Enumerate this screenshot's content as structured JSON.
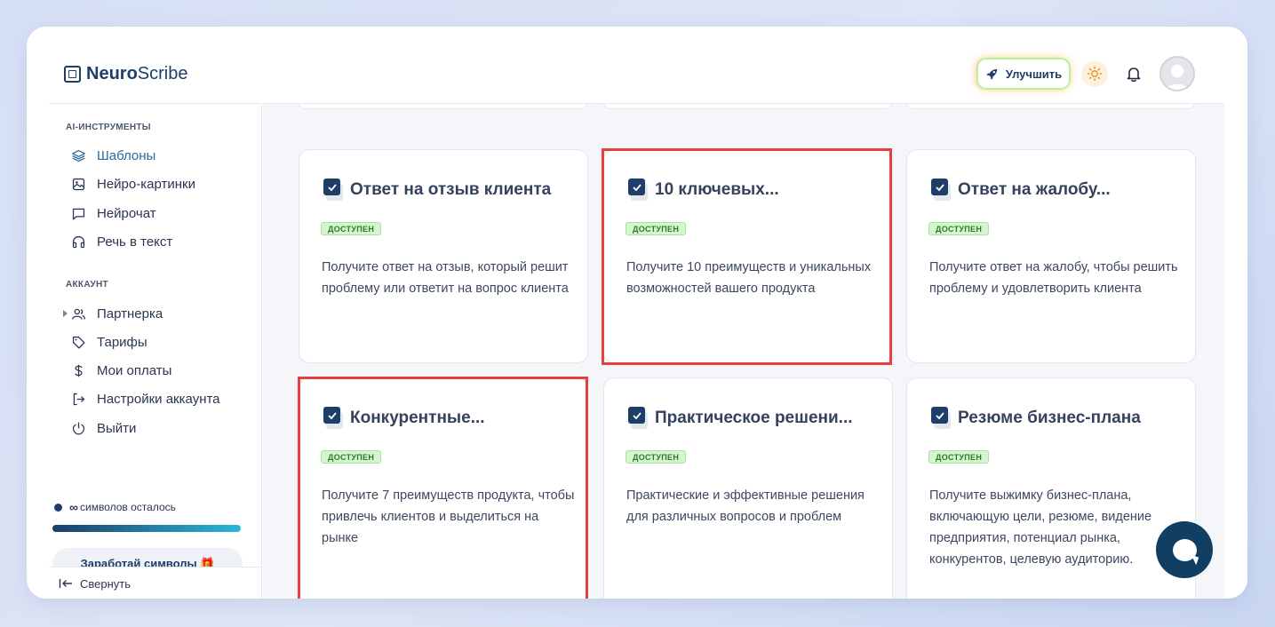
{
  "header": {
    "logo_bold": "Neuro",
    "logo_light": "Scribe",
    "upgrade_label": "Улучшить"
  },
  "sidebar": {
    "section_tools": "AI-ИНСТРУМЕНТЫ",
    "tools": [
      {
        "label": "Шаблоны",
        "icon": "layers-icon",
        "active": true
      },
      {
        "label": "Нейро-картинки",
        "icon": "image-icon"
      },
      {
        "label": "Нейрочат",
        "icon": "chat-icon"
      },
      {
        "label": "Речь в текст",
        "icon": "headphones-icon"
      }
    ],
    "section_account": "АККАУНТ",
    "account": [
      {
        "label": "Партнерка",
        "icon": "users-icon"
      },
      {
        "label": "Тарифы",
        "icon": "tag-icon"
      },
      {
        "label": "Мои оплаты",
        "icon": "dollar-icon"
      },
      {
        "label": "Настройки аккаунта",
        "icon": "logout-arrow-icon"
      },
      {
        "label": "Выйти",
        "icon": "power-icon"
      }
    ],
    "credits_value": "∞",
    "credits_label": "символов осталось",
    "credits_fill": 1.0,
    "earn_label": "Заработай символы 🎁",
    "collapse_label": "Свернуть"
  },
  "cards": [
    {
      "title": "Ответ на отзыв клиента",
      "badge": "ДОСТУПЕН",
      "desc": "Получите ответ на отзыв, который решит проблему или ответит на вопрос клиента"
    },
    {
      "title": "10 ключевых...",
      "badge": "ДОСТУПЕН",
      "desc": "Получите 10 преимуществ и уникальных возможностей вашего продукта"
    },
    {
      "title": "Ответ на жалобу...",
      "badge": "ДОСТУПЕН",
      "desc": "Получите ответ на жалобу, чтобы решить проблему и удовлетворить клиента"
    },
    {
      "title": "Конкурентные...",
      "badge": "ДОСТУПЕН",
      "desc": "Получите 7 преимуществ продукта, чтобы привлечь клиентов и выделиться на рынке"
    },
    {
      "title": "Практическое решени...",
      "badge": "ДОСТУПЕН",
      "desc": "Практические и эффективные решения для различных вопросов и проблем"
    },
    {
      "title": "Резюме бизнес-плана",
      "badge": "ДОСТУПЕН",
      "desc": "Получите выжимку бизнес-плана, включающую цели, резюме, видение предприятия, потенциал рынка, конкурентов, целевую аудиторию."
    }
  ],
  "colors": {
    "brand": "#1d3e68",
    "active_nav": "#2b6b9e",
    "badge_bg": "#d4f5cf",
    "highlight": "#e8403f",
    "chat_fab": "#113f63"
  }
}
